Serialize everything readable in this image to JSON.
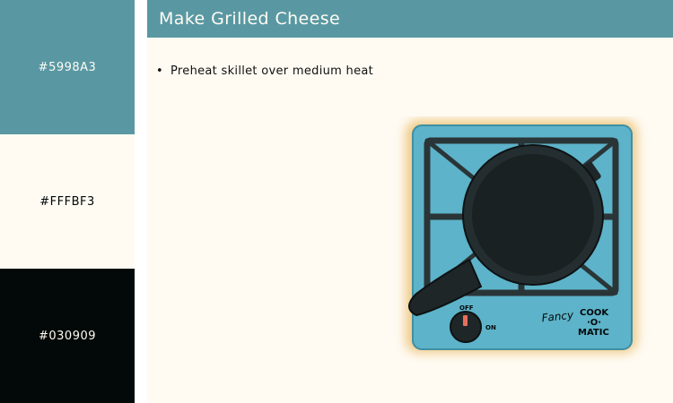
{
  "palette": {
    "swatches": [
      {
        "label": "#5998A3",
        "color": "#5998A3",
        "text_color": "#FFFBF3"
      },
      {
        "label": "#FFFBF3",
        "color": "#FFFBF3",
        "text_color": "#030909"
      },
      {
        "label": "#030909",
        "color": "#030909",
        "text_color": "#FFFBF3"
      }
    ]
  },
  "header": {
    "title": "Make Grilled Cheese"
  },
  "steps": [
    {
      "bullet": "•",
      "text": "Preheat skillet over medium heat"
    }
  ],
  "stove": {
    "knob_off_label": "OFF",
    "knob_on_label": "ON",
    "brand_script": "Fancy",
    "brand_line1": "COOK",
    "brand_line2": "·O·",
    "brand_line3": "MATIC",
    "body_color": "#5DB3C9",
    "glow_color": "#E8B860",
    "knob_indicator_color": "#E8705A"
  }
}
